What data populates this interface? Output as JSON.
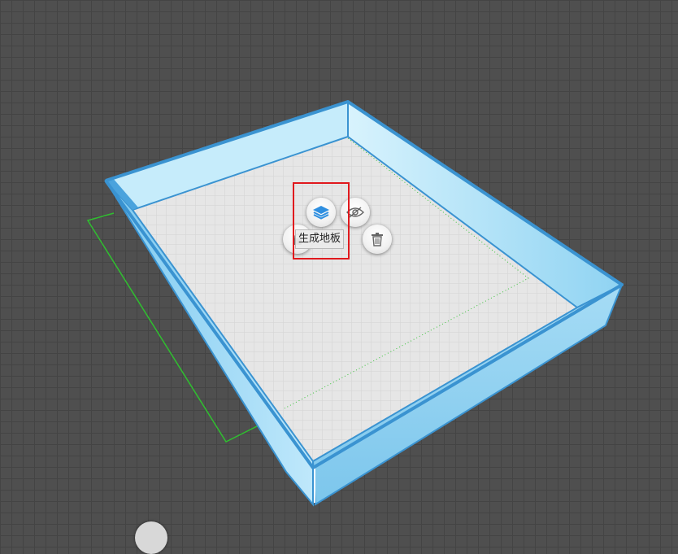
{
  "scene": {
    "background_color": "#4f4f4f",
    "grid_color": "#444444",
    "wall_color": "#8fd3f2",
    "wall_edge_color": "#3a93d1",
    "floor_color": "#e4e4e4",
    "outline_color": "#2fbf2f"
  },
  "context_menu": {
    "buttons": [
      {
        "name": "generate-floor",
        "icon": "layers-icon",
        "tooltip": "生成地板"
      },
      {
        "name": "hide",
        "icon": "eye-slash-icon"
      },
      {
        "name": "lock",
        "icon": "lock-icon"
      },
      {
        "name": "delete",
        "icon": "trash-icon"
      }
    ],
    "tooltip_text": "生成地板",
    "highlight_color": "#e0191d"
  }
}
